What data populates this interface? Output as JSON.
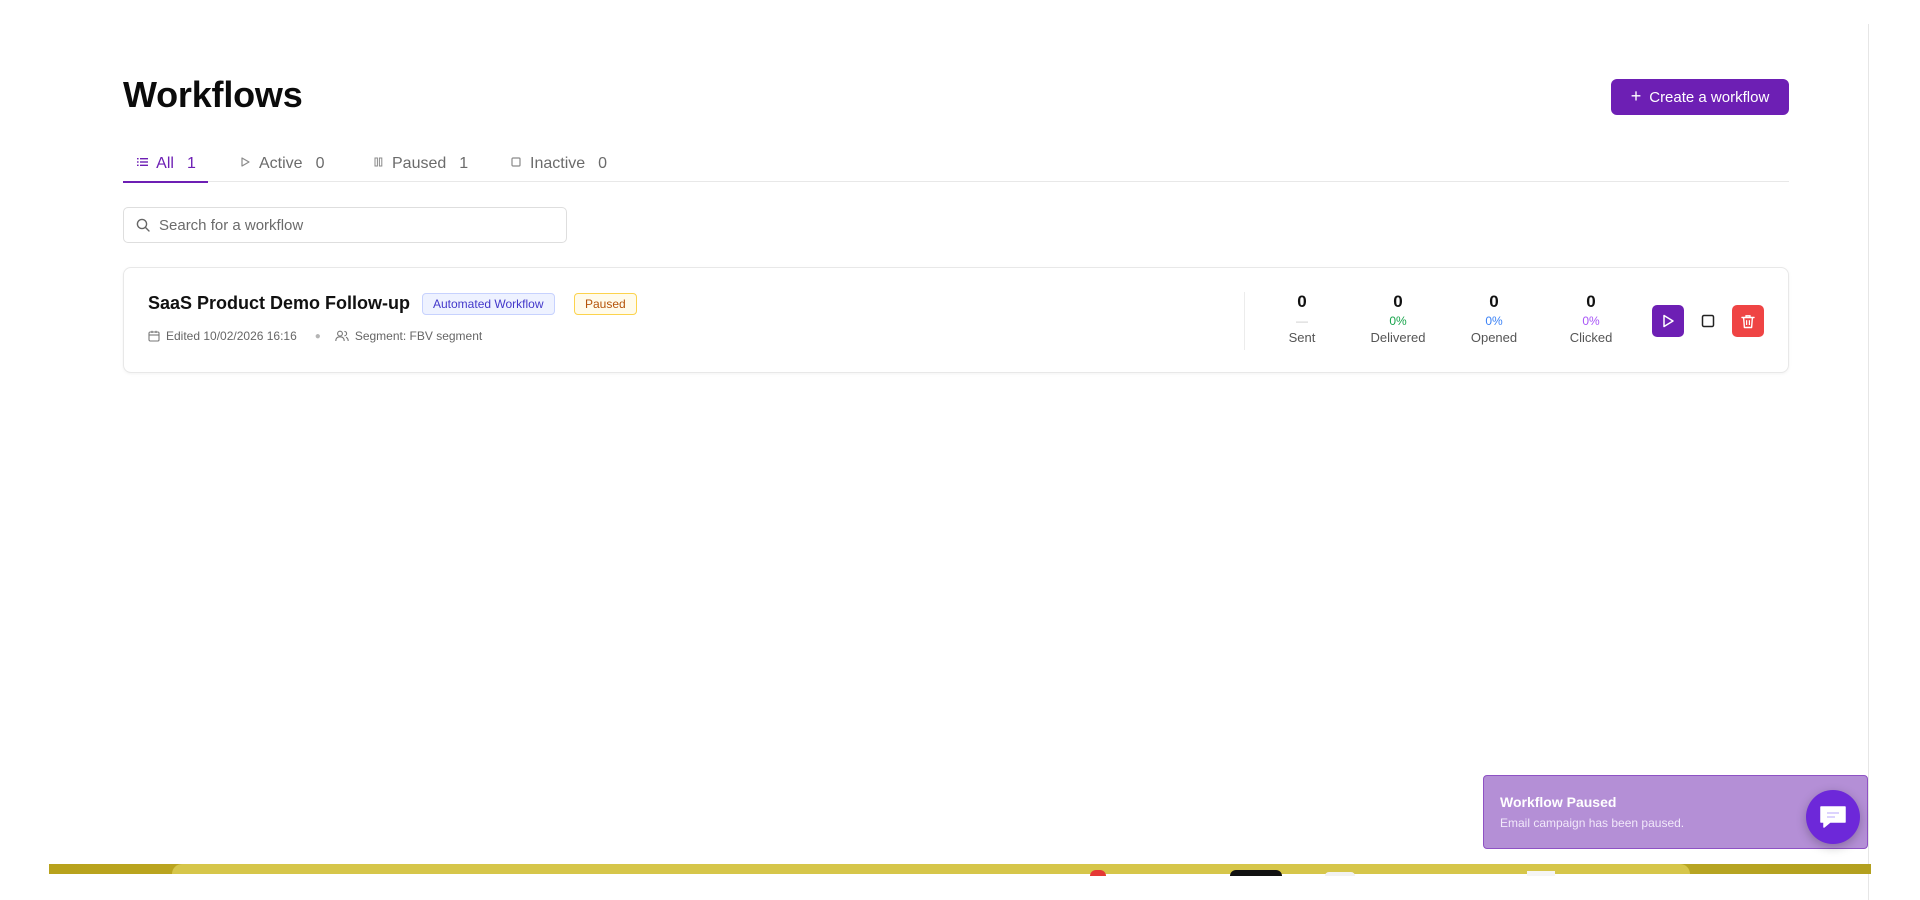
{
  "page": {
    "title": "Workflows"
  },
  "header": {
    "create_label": "Create a workflow"
  },
  "tabs": [
    {
      "label": "All",
      "count": "1",
      "icon": "list-icon"
    },
    {
      "label": "Active",
      "count": "0",
      "icon": "play-outline-icon"
    },
    {
      "label": "Paused",
      "count": "1",
      "icon": "pause-icon"
    },
    {
      "label": "Inactive",
      "count": "0",
      "icon": "square-icon"
    }
  ],
  "search": {
    "placeholder": "Search for a workflow",
    "value": ""
  },
  "workflows": [
    {
      "name": "SaaS Product Demo Follow-up",
      "type_badge": "Automated Workflow",
      "status_badge": "Paused",
      "edited": "Edited 10/02/2026 16:16",
      "segment": "Segment: FBV segment",
      "stats": {
        "sent": {
          "value": "0",
          "pct": "—",
          "label": "Sent"
        },
        "delivered": {
          "value": "0",
          "pct": "0%",
          "label": "Delivered"
        },
        "opened": {
          "value": "0",
          "pct": "0%",
          "label": "Opened"
        },
        "clicked": {
          "value": "0",
          "pct": "0%",
          "label": "Clicked"
        }
      }
    }
  ],
  "toast": {
    "title": "Workflow Paused",
    "message": "Email campaign has been paused."
  },
  "colors": {
    "accent": "#6d1fb4",
    "delete": "#ef4444",
    "delivered": "#16a34a",
    "opened": "#3b82f6",
    "clicked": "#a855f7",
    "paused_badge": "#b45309",
    "automated_badge": "#4338ca",
    "toast_bg": "#b48fd6"
  }
}
